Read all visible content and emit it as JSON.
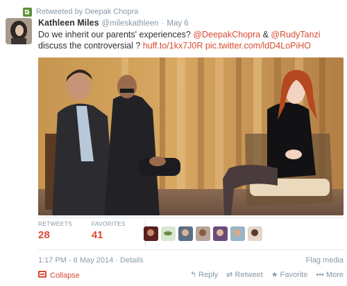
{
  "retweet_bar": {
    "prefix": "Retweeted by",
    "retweeter": "Deepak Chopra"
  },
  "tweet": {
    "author": {
      "fullname": "Kathleen Miles",
      "username": "@mileskathleen"
    },
    "separator": "·",
    "time": "May 6",
    "text": {
      "part1": "Do we inherit our parents' experiences? ",
      "mention1": "@DeepakChopra",
      "part2": " & ",
      "mention2": "@RudyTanzi",
      "part3": " discuss the controversial ? ",
      "link1": "huff.to/1kx7J0R",
      "part4": " ",
      "link2": "pic.twitter.com/ldD4LoPiHO"
    }
  },
  "stats": {
    "retweets_label": "RETWEETS",
    "retweets_value": "28",
    "favorites_label": "FAVORITES",
    "favorites_value": "41"
  },
  "footer": {
    "timestamp": "1:17 PM - 6 May 2014",
    "details_sep": " · ",
    "details": "Details",
    "flag": "Flag media"
  },
  "actions": {
    "collapse": "Collapse",
    "reply": "Reply",
    "retweet": "Retweet",
    "favorite": "Favorite",
    "more": "More"
  },
  "colors": {
    "link": "#d94a30",
    "muted": "#8899a6",
    "text": "#292f33",
    "retweet_green": "#5c913b"
  },
  "icons": {
    "retweet_bar": "retweet-icon",
    "collapse": "collapse-icon",
    "reply": "reply-arrow-icon",
    "retweet": "retweet-icon",
    "favorite": "star-icon",
    "more": "ellipsis-icon"
  }
}
